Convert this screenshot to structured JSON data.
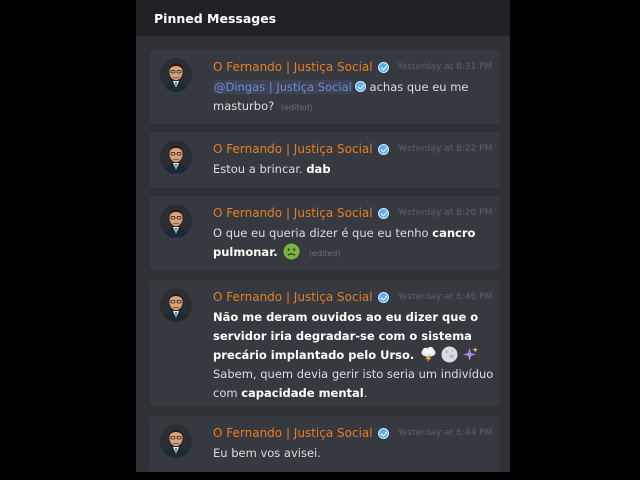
{
  "panel": {
    "title": "Pinned Messages"
  },
  "colors": {
    "author": "#e67e22",
    "mention": "#7289da",
    "panel_bg": "#2f3136",
    "card_bg": "#36393f",
    "header_bg": "#202225"
  },
  "messages": [
    {
      "author": "O Fernando | Justiça Social",
      "timestamp": "Yesterday at 8:31 PM",
      "mention": "@Dingas | Justiça Social",
      "text_a": " achas que eu me masturbo?",
      "edited": "(edited)"
    },
    {
      "author": "O Fernando | Justiça Social",
      "timestamp": "Yesterday at 8:22 PM",
      "text_a": "Estou a brincar. ",
      "bold_a": "dab"
    },
    {
      "author": "O Fernando | Justiça Social",
      "timestamp": "Yesterday at 8:20 PM",
      "text_a": "O que eu queria dizer é que eu tenho ",
      "bold_a": "cancro pulmonar.",
      "edited": "(edited)",
      "emoji": "nauseated-face-icon"
    },
    {
      "author": "O Fernando | Justiça Social",
      "timestamp": "Yesterday at 6:46 PM",
      "bold_a": "Não me deram ouvidos ao eu dizer que o servidor iria degradar-se com o sistema precário implantado pelo Urso.",
      "emojis": [
        "thunder-cloud-icon",
        "full-moon-icon",
        "sparkles-icon"
      ],
      "text_a": "Sabem, quem devia gerir isto seria um indivíduo com ",
      "bold_b": "capacidade mental",
      "text_b": "."
    },
    {
      "author": "O Fernando | Justiça Social",
      "timestamp": "Yesterday at 6:44 PM",
      "text_a": "Eu bem vos avisei."
    }
  ]
}
